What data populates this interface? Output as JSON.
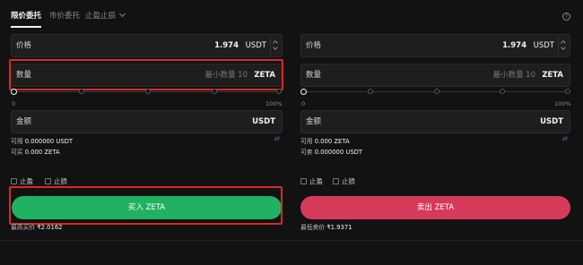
{
  "tabs": [
    {
      "label": "限价委托",
      "active": true
    },
    {
      "label": "市价委托",
      "active": false
    },
    {
      "label": "止盈止损",
      "active": false
    }
  ],
  "buy": {
    "price_label": "价格",
    "price_value": "1.974",
    "price_unit": "USDT",
    "qty_label": "数量",
    "qty_placeholder": "最小数量 10",
    "qty_unit": "ZETA",
    "slider_min": "0",
    "slider_max": "100%",
    "amount_label": "金额",
    "amount_unit": "USDT",
    "available_label": "可用",
    "available_value": "0.000000 USDT",
    "can_label": "可买",
    "can_value": "0.000 ZETA",
    "take_profit": "止盈",
    "stop_loss": "止损",
    "button": "买入 ZETA",
    "footer_label": "最高买价",
    "footer_value": "₹2.0162"
  },
  "sell": {
    "price_label": "价格",
    "price_value": "1.974",
    "price_unit": "USDT",
    "qty_label": "数量",
    "qty_placeholder": "最小数量 10",
    "qty_unit": "ZETA",
    "slider_min": "0",
    "slider_max": "100%",
    "amount_label": "金额",
    "amount_unit": "USDT",
    "available_label": "可用",
    "available_value": "0.000 ZETA",
    "can_label": "可卖",
    "can_value": "0.000000 USDT",
    "take_profit": "止盈",
    "stop_loss": "止损",
    "button": "卖出 ZETA",
    "footer_label": "最低卖价",
    "footer_value": "₹1.9371"
  },
  "colors": {
    "buy": "#20b163",
    "sell": "#d63a5b",
    "highlight": "#d62a2a"
  },
  "icons": {
    "help": "question-circle-icon",
    "transfer": "transfer-icon",
    "dropdown": "chevron-down-icon"
  }
}
